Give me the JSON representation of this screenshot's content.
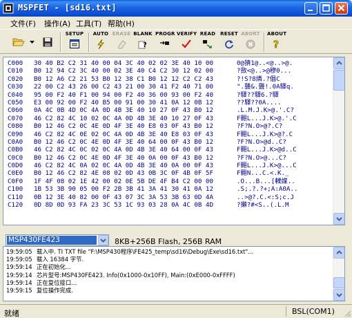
{
  "window": {
    "title": "MSPFET - [sd16.txt]"
  },
  "menu": [
    {
      "label": "文件(F)"
    },
    {
      "label": "操作(A)"
    },
    {
      "label": "工具(T)"
    },
    {
      "label": "帮助(H)"
    }
  ],
  "toolbar": {
    "setup": "SETUP",
    "auto": "AUTO",
    "erase": "ERASE",
    "blank": "BLANK",
    "progr": "PROGR",
    "verify": "VERIFY",
    "read": "READ",
    "reset": "RESET",
    "abort": "ABORT",
    "about": "ABOUT"
  },
  "hex_rows": [
    {
      "addr": "C000",
      "bytes": "30 40 B2 C2 31 40 00 04 3C 40 02 02 3E 40 10 00",
      "ascii": "0@猜1@..<@..>@."
    },
    {
      "addr": "C010",
      "bytes": "B0 12 94 C2 3C 40 00 02 3E 40 C4 C2 30 12 02 00",
      "ascii": "?敳<@..>@穆0..."
    },
    {
      "addr": "C020",
      "bytes": "B0 12 A6 C2 21 53 B0 12 38 C1 B0 12 12 C2 C2 43",
      "ascii": "?!S?8燐.?倡C"
    },
    {
      "addr": "C030",
      "bytes": "22 00 C2 43 26 00 C2 43 21 00 30 41 F2 40 71 00",
      "ascii": "\".聾&.聾!.0A驛q."
    },
    {
      "addr": "C040",
      "bytes": "95 00 F2 40 F1 00 94 00 F2 40 36 00 93 00 F2 40",
      "ascii": "?驛??驛6.?驛"
    },
    {
      "addr": "C050",
      "bytes": "E3 00 92 00 F2 40 B5 00 91 00 30 41 0A 12 0B 12",
      "ascii": "??驛??0A...."
    },
    {
      "addr": "C060",
      "bytes": "0A 4C 0B 4D 0C 4A 0D 4B 3E 40 10 27 0F 43 B0 12",
      "ascii": ".L.M.J.K>@.'.C?"
    },
    {
      "addr": "C070",
      "bytes": "46 C2 82 4C 10 02 0C 4A 0D 4B 3E 40 10 27 0F 43",
      "ascii": "F翾L...J.K>@.'.C"
    },
    {
      "addr": "C080",
      "bytes": "B0 12 46 C2 0C 4E 0D 4F 3E 40 E8 03 0F 43 B0 12",
      "ascii": "?F?N.O>@?.C?"
    },
    {
      "addr": "C090",
      "bytes": "46 C2 82 4C 0E 02 0C 4A 0D 4B 3E 40 E8 03 0F 43",
      "ascii": "F翾L...J.K>@?.C"
    },
    {
      "addr": "C0A0",
      "bytes": "B0 12 46 C2 0C 4E 0D 4F 3E 40 64 00 0F 43 B0 12",
      "ascii": "?F?N.O>@d..C?"
    },
    {
      "addr": "C0B0",
      "bytes": "46 C2 82 4C 0C 02 0C 4A 0D 4B 3E 40 64 00 0F 43",
      "ascii": "F翾L...J.K>@d..C"
    },
    {
      "addr": "C0C0",
      "bytes": "B0 12 46 C2 0C 4E 0D 4F 3E 40 0A 00 0F 43 B0 12",
      "ascii": "?F?N.O>@...C?"
    },
    {
      "addr": "C0D0",
      "bytes": "46 C2 82 4C 0A 02 0C 4A 0D 4B 3E 40 0A 00 0F 43",
      "ascii": "F翾L...J.K>@...C"
    },
    {
      "addr": "C0E0",
      "bytes": "B0 12 46 C2 82 4E 08 02 0D 43 0B 3C 0F 4B 0F 5F",
      "ascii": "F翾N...C.<.K._"
    },
    {
      "addr": "C0F0",
      "bytes": "1F 4F 08 02 1E 42 00 02 0E 5B DE 4F B4 C2 00 00",
      "ascii": ".O...B...[轐媒.."
    },
    {
      "addr": "C100",
      "bytes": "1B 53 3B 90 05 00 F2 2B 3B 41 3A 41 30 41 0A 12",
      "ascii": ".S;.?.?+;A:A0A.."
    },
    {
      "addr": "C110",
      "bytes": "0B 12 3E 40 82 00 0F 43 07 3C 3A 53 3B 63 0D 4A",
      "ascii": "..>@?.C.<:S;c.J"
    },
    {
      "addr": "C120",
      "bytes": "0D 8D 0D 93 FA 23 3C 53 1C 93 03 28 0A 4C 0B 4D",
      "ascii": "?攋?#<S..(.L.M"
    }
  ],
  "device": {
    "selected": "MSP430FE423",
    "info": "8KB+256B Flash, 256B RAM"
  },
  "log": [
    {
      "time": "19:59:05",
      "text": "载入中. TI TXT file \"F:\\MSP430程序\\FE425_temp\\sd16\\Debug\\Exe\\sd16.txt\"..."
    },
    {
      "time": "19:59:05",
      "text": "载入 16384 字节."
    },
    {
      "time": "19:59:14",
      "text": "正在初始化..."
    },
    {
      "time": "19:59:14",
      "text": "芯片型号:MSP430FE423. Info(0x1000-0x10FF), Main:(0xE000-0xFFFF)"
    },
    {
      "time": "19:59:14",
      "text": "正在复位接口..."
    },
    {
      "time": "19:59:15",
      "text": "复位操作完成."
    }
  ],
  "status": {
    "left": "就绪",
    "right": "BSL(COM1)"
  }
}
